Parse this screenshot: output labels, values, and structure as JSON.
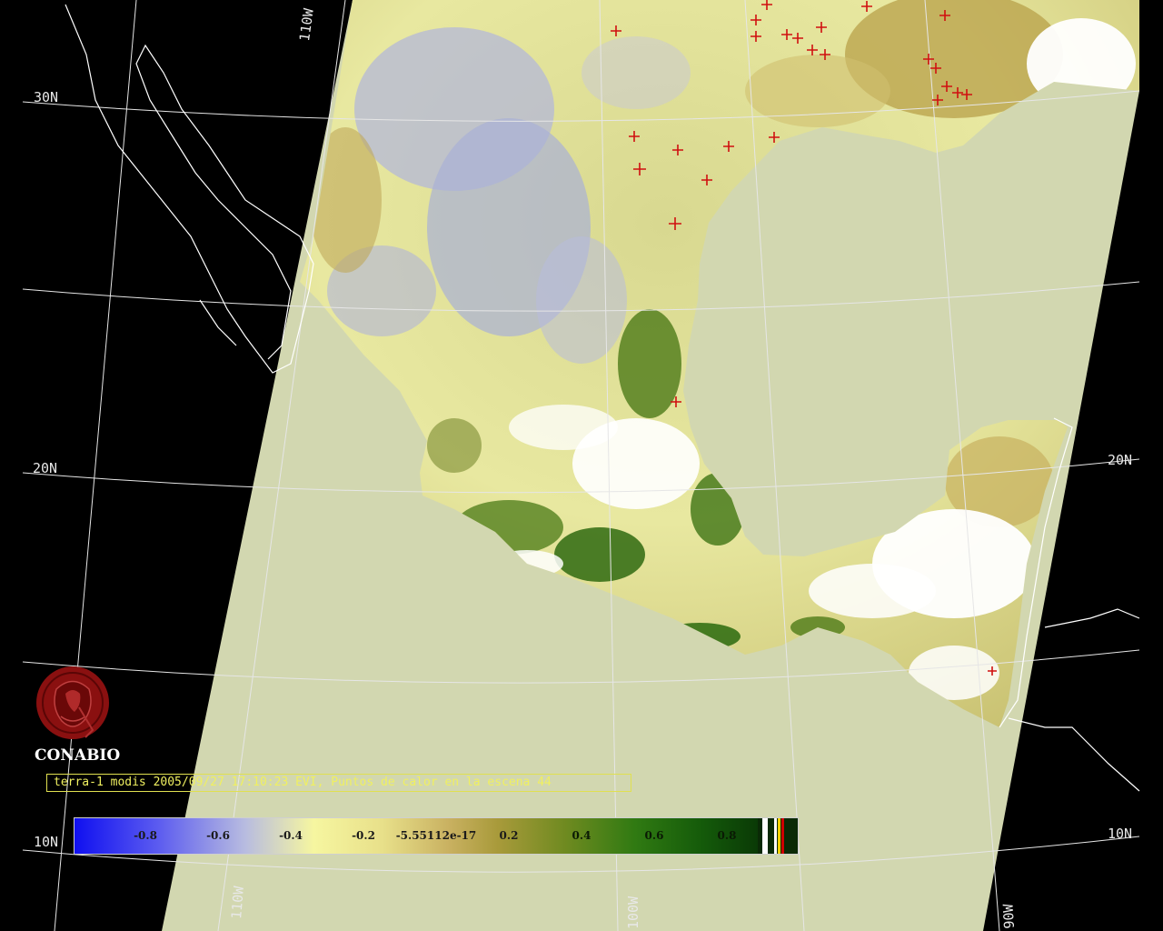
{
  "grid_labels": {
    "lat_30n": "30N",
    "lat_20n_left": "20N",
    "lat_20n_right": "20N",
    "lat_10n_left": "10N",
    "lat_10n_right": "10N",
    "lon_110w_top": "110W",
    "lon_110w_bottom": "110W",
    "lon_100w_bottom": "100W",
    "lon_90w_bottom": "90W"
  },
  "logo": {
    "icon": "conabio-logo-icon",
    "text": "CONABIO"
  },
  "caption": {
    "text": "terra-1 modis 2005/09/27 17:10:23 EVI, Puntos de calor en la escena 44"
  },
  "legend": {
    "ticks": [
      {
        "label": "-0.8",
        "value": -0.8
      },
      {
        "label": "-0.6",
        "value": -0.6
      },
      {
        "label": "-0.4",
        "value": -0.4
      },
      {
        "label": "-0.2",
        "value": -0.2
      },
      {
        "label": "-5.55112e-17",
        "value": 0.0
      },
      {
        "label": "0.2",
        "value": 0.2
      },
      {
        "label": "0.4",
        "value": 0.4
      },
      {
        "label": "0.6",
        "value": 0.6
      },
      {
        "label": "0.8",
        "value": 0.8
      }
    ],
    "range": [
      -1.0,
      1.0
    ],
    "colors": {
      "low": "#1010f0",
      "neutral_low": "#f4f4a8",
      "neutral_high": "#c0a040",
      "high": "#0a3a06",
      "no_data": "#ffffff",
      "fire": "#d00000",
      "fire_alt": "#f0d000"
    }
  },
  "map_colors": {
    "background": "#000000",
    "ocean_in_swath": "#d2d7b0",
    "coastline": "#ffffff",
    "graticule": "#e6e6e6",
    "hotspot": "#d01010"
  }
}
